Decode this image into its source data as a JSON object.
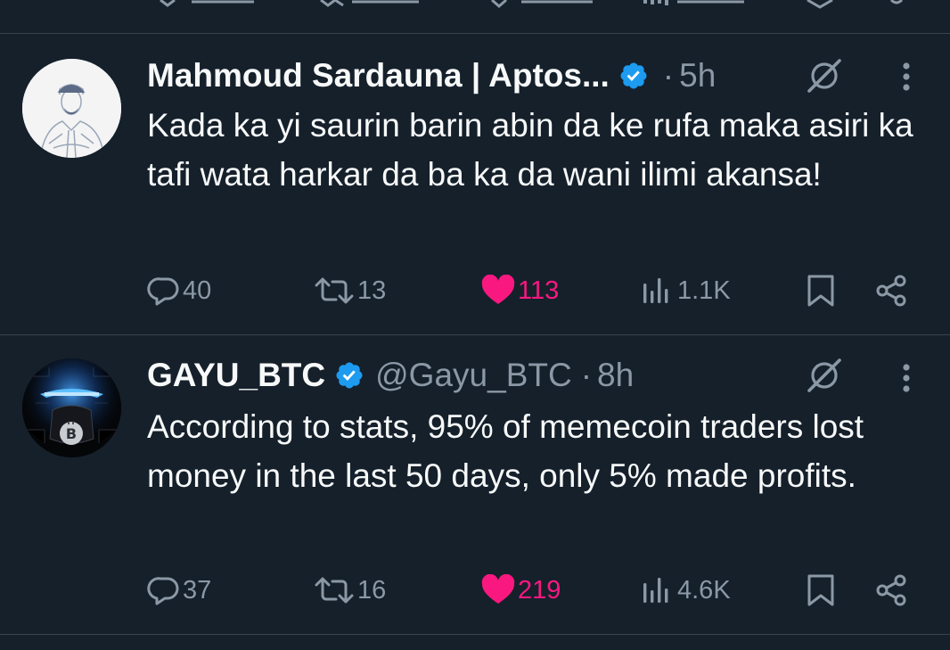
{
  "tweets": [
    {
      "display_name": "Mahmoud Sardauna | Aptos...",
      "handle": "",
      "time": "5h",
      "text": "Kada ka yi saurin barin abin da ke rufa maka asiri ka tafi wata harkar da ba ka da wani ilimi akansa!",
      "replies": "40",
      "retweets": "13",
      "likes": "113",
      "views": "1.1K",
      "liked": true,
      "verified": true
    },
    {
      "display_name": "GAYU_BTC",
      "handle": "@Gayu_BTC",
      "time": "8h",
      "text": "According to stats, 95% of memecoin traders lost money in the last 50 days, only 5% made profits.",
      "replies": "37",
      "retweets": "16",
      "likes": "219",
      "views": "4.6K",
      "liked": true,
      "verified": true
    }
  ],
  "separator": "·",
  "icons": {
    "reply": "reply-icon",
    "retweet": "retweet-icon",
    "like": "heart-icon",
    "views": "views-icon",
    "bookmark": "bookmark-icon",
    "share": "share-icon",
    "grok": "grok-icon",
    "more": "more-icon",
    "verified": "verified-badge-icon"
  },
  "colors": {
    "background": "#15202b",
    "text": "#f7f9f9",
    "muted": "#8b98a5",
    "like": "#f91880",
    "verified": "#1d9bf0",
    "divider": "#38444d"
  }
}
